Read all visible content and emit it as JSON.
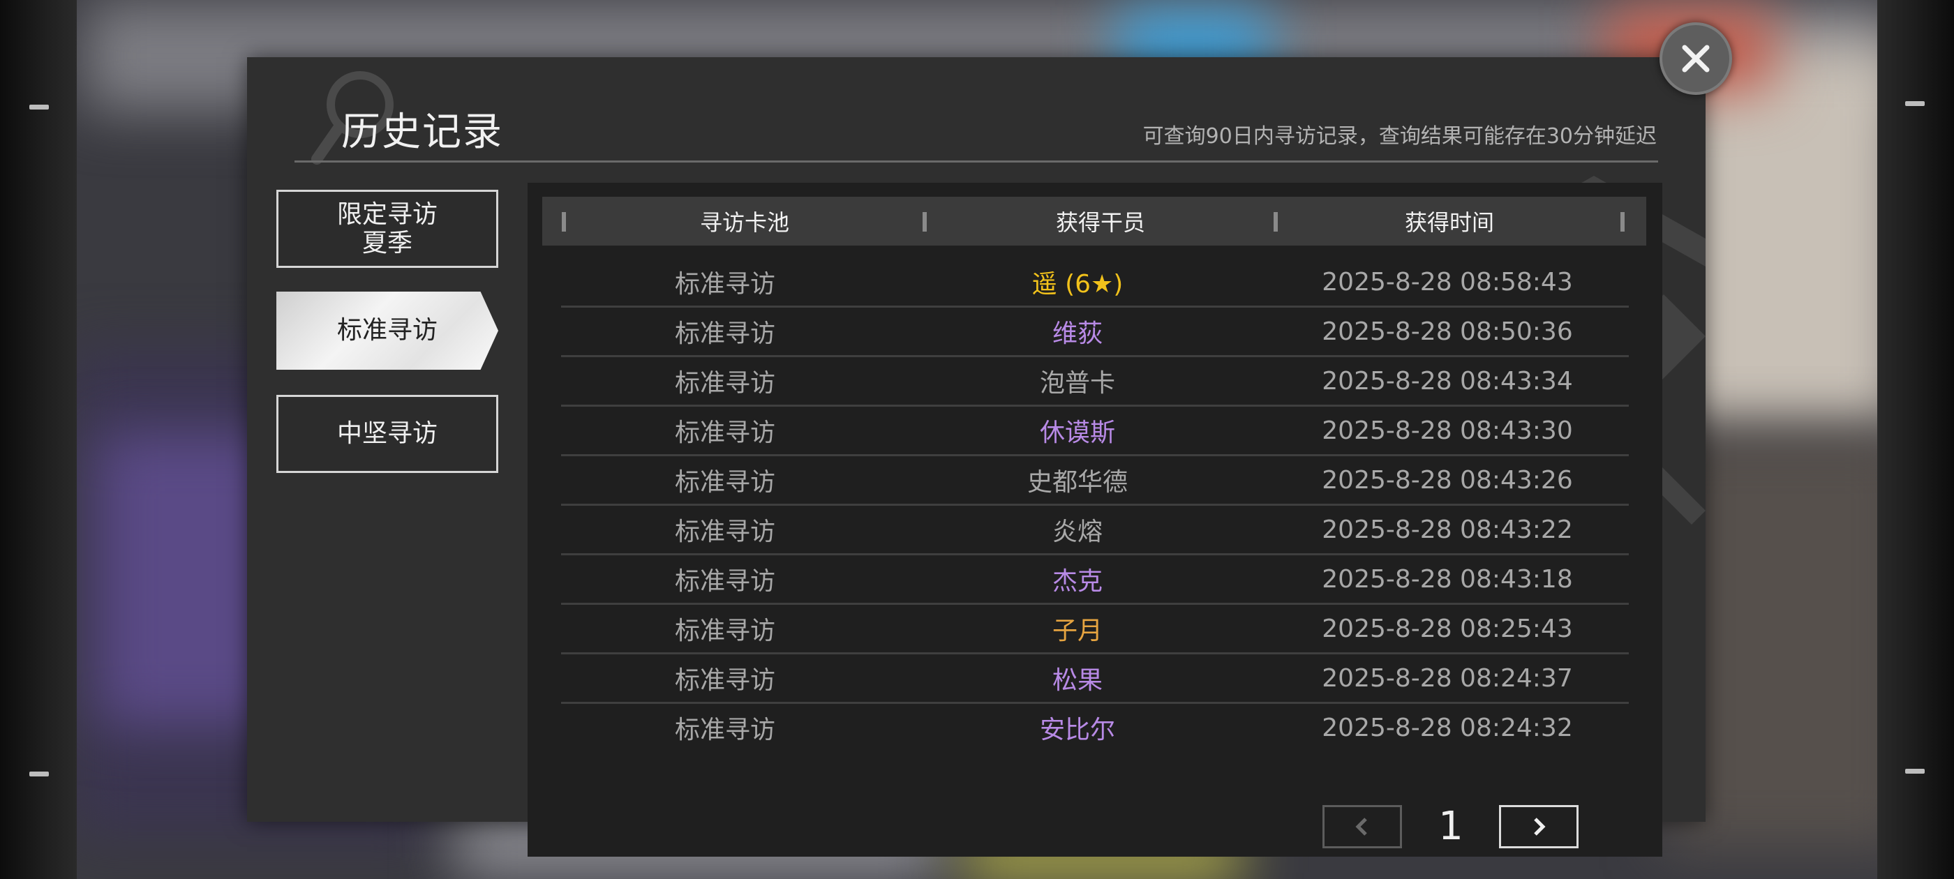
{
  "dialog": {
    "title": "历史记录",
    "hint": "可查询90日内寻访记录，查询结果可能存在30分钟延迟"
  },
  "tabs": [
    {
      "line1": "限定寻访",
      "line2": "夏季",
      "selected": false
    },
    {
      "label": "标准寻访",
      "selected": true
    },
    {
      "label": "中坚寻访",
      "selected": false
    }
  ],
  "table": {
    "headers": [
      "寻访卡池",
      "获得干员",
      "获得时间"
    ],
    "rows": [
      {
        "pool": "标准寻访",
        "operator": "遥 (6★)",
        "time": "2025-8-28 08:58:43",
        "color": "#f2c21b"
      },
      {
        "pool": "标准寻访",
        "operator": "维荻",
        "time": "2025-8-28 08:50:36",
        "color": "#b88ae6"
      },
      {
        "pool": "标准寻访",
        "operator": "泡普卡",
        "time": "2025-8-28 08:43:34",
        "color": "#a8a8a8"
      },
      {
        "pool": "标准寻访",
        "operator": "休谟斯",
        "time": "2025-8-28 08:43:30",
        "color": "#b88ae6"
      },
      {
        "pool": "标准寻访",
        "operator": "史都华德",
        "time": "2025-8-28 08:43:26",
        "color": "#a8a8a8"
      },
      {
        "pool": "标准寻访",
        "operator": "炎熔",
        "time": "2025-8-28 08:43:22",
        "color": "#a8a8a8"
      },
      {
        "pool": "标准寻访",
        "operator": "杰克",
        "time": "2025-8-28 08:43:18",
        "color": "#b88ae6"
      },
      {
        "pool": "标准寻访",
        "operator": "子月",
        "time": "2025-8-28 08:25:43",
        "color": "#e6a440"
      },
      {
        "pool": "标准寻访",
        "operator": "松果",
        "time": "2025-8-28 08:24:37",
        "color": "#b88ae6"
      },
      {
        "pool": "标准寻访",
        "operator": "安比尔",
        "time": "2025-8-28 08:24:32",
        "color": "#b88ae6"
      }
    ]
  },
  "pager": {
    "page": "1",
    "prev_icon": "chevron-left-icon",
    "next_icon": "chevron-right-icon"
  },
  "close_icon": "close-icon"
}
